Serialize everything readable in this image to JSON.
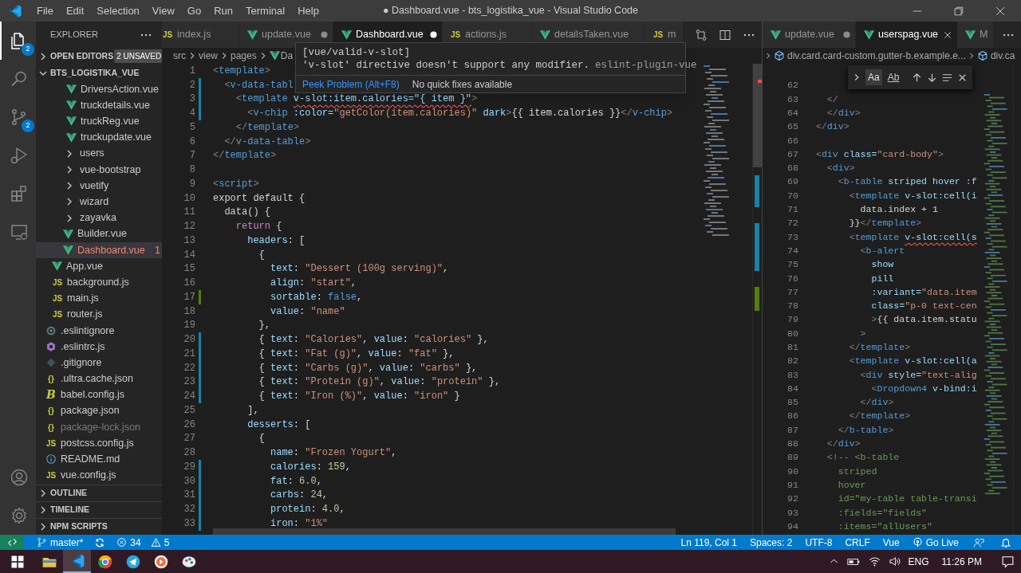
{
  "window": {
    "title": "● Dashboard.vue - bts_logistika_vue - Visual Studio Code"
  },
  "menu": [
    "File",
    "Edit",
    "Selection",
    "View",
    "Go",
    "Run",
    "Terminal",
    "Help"
  ],
  "activity_bar": {
    "items": [
      {
        "kind": "explorer",
        "selected": true,
        "badge": "2"
      },
      {
        "kind": "search",
        "selected": false
      },
      {
        "kind": "source-control",
        "selected": false,
        "badge": "2"
      },
      {
        "kind": "run",
        "selected": false
      },
      {
        "kind": "extensions",
        "selected": false
      },
      {
        "kind": "remote",
        "selected": false
      }
    ],
    "bottom": [
      {
        "kind": "account"
      },
      {
        "kind": "settings"
      }
    ]
  },
  "sidebar": {
    "title": "EXPLORER",
    "sections": [
      {
        "title": "OPEN EDITORS",
        "expanded": false,
        "badge": "2 UNSAVED"
      },
      {
        "title": "BTS_LOGISTIKA_VUE",
        "expanded": true
      }
    ],
    "tree": [
      {
        "children": [
          {
            "children": [
              {
                "children": [
                  {
                    "label": "DriversAction.vue",
                    "kind": "vue",
                    "selected": false,
                    "dimmed": false
                  },
                  {
                    "label": "truckdetails.vue",
                    "kind": "vue",
                    "selected": false,
                    "dimmed": false
                  },
                  {
                    "label": "truckReg.vue",
                    "kind": "vue",
                    "selected": false,
                    "dimmed": false
                  },
                  {
                    "label": "truckupdate.vue",
                    "kind": "vue",
                    "selected": false,
                    "dimmed": false
                  }
                ]
              },
              {
                "label": "users",
                "kind": "folder",
                "expanded": false,
                "selected": false,
                "dimmed": false
              },
              {
                "label": "vue-bootstrap",
                "kind": "folder",
                "expanded": false,
                "selected": false,
                "dimmed": false
              },
              {
                "label": "vuetify",
                "kind": "folder",
                "expanded": false,
                "selected": false,
                "dimmed": false
              },
              {
                "label": "wizard",
                "kind": "folder",
                "expanded": false,
                "selected": false,
                "dimmed": false
              },
              {
                "label": "zayavka",
                "kind": "folder",
                "expanded": false,
                "selected": false,
                "dimmed": false
              },
              {
                "label": "Builder.vue",
                "kind": "vue",
                "selected": false,
                "dimmed": false
              },
              {
                "label": "Dashboard.vue",
                "kind": "vue",
                "selected": true,
                "dimmed": false,
                "problems": "1"
              }
            ]
          },
          {
            "label": "App.vue",
            "kind": "vue",
            "selected": false,
            "dimmed": false
          },
          {
            "label": "background.js",
            "kind": "js",
            "icon_label": "JS",
            "selected": false,
            "dimmed": false
          },
          {
            "label": "main.js",
            "kind": "js",
            "icon_label": "JS",
            "selected": false,
            "dimmed": false
          },
          {
            "label": "router.js",
            "kind": "js",
            "icon_label": "JS",
            "selected": false,
            "dimmed": false
          }
        ]
      },
      {
        "label": ".eslintignore",
        "kind": "ignore",
        "selected": false,
        "dimmed": false
      },
      {
        "label": ".eslintrc.js",
        "kind": "lint",
        "selected": false,
        "dimmed": false
      },
      {
        "label": ".gitignore",
        "kind": "git",
        "selected": false,
        "dimmed": false
      },
      {
        "label": ".ultra.cache.json",
        "kind": "json",
        "icon_label": "{}",
        "selected": false,
        "dimmed": false
      },
      {
        "label": "babel.config.js",
        "kind": "babel",
        "icon_label": "B",
        "selected": false,
        "dimmed": false
      },
      {
        "label": "package.json",
        "kind": "json",
        "icon_label": "{}",
        "selected": false,
        "dimmed": false
      },
      {
        "label": "package-lock.json",
        "kind": "json",
        "icon_label": "{}",
        "selected": false,
        "dimmed": true
      },
      {
        "label": "postcss.config.js",
        "kind": "js",
        "icon_label": "JS",
        "selected": false,
        "dimmed": false
      },
      {
        "label": "README.md",
        "kind": "info",
        "selected": false,
        "dimmed": false
      },
      {
        "label": "vue.config.js",
        "kind": "js",
        "icon_label": "JS",
        "selected": false,
        "dimmed": false
      }
    ],
    "bottom_sections": [
      {
        "title": "OUTLINE",
        "expanded": false
      },
      {
        "title": "TIMELINE",
        "expanded": false
      },
      {
        "title": "NPM SCRIPTS",
        "expanded": false
      }
    ]
  },
  "editor_groups": [
    {
      "tabs": [
        {
          "label": "index.js",
          "kind": "js",
          "icon_label": "JS",
          "selected": false,
          "dirty": false
        },
        {
          "label": "update.vue",
          "kind": "vue",
          "selected": false,
          "dirty": true
        },
        {
          "label": "Dashboard.vue",
          "kind": "vue",
          "selected": true,
          "dirty": true
        },
        {
          "label": "actions.js",
          "kind": "js",
          "icon_label": "JS",
          "selected": false,
          "dirty": false
        },
        {
          "label": "detailsTaken.vue",
          "kind": "vue",
          "selected": false,
          "dirty": false
        },
        {
          "label": "m",
          "kind": "js",
          "icon_label": "JS",
          "selected": false,
          "dirty": false
        }
      ],
      "breadcrumbs": [
        {
          "label": "src",
          "kind": "folder"
        },
        {
          "label": "view",
          "kind": "folder"
        },
        {
          "label": "pages",
          "kind": "folder"
        },
        {
          "label": "Da",
          "kind": "vue"
        }
      ],
      "hover": {
        "rule": "[vue/valid-v-slot]",
        "message": "'v-slot' directive doesn't support any modifier.",
        "source": "eslint-plugin-vue",
        "actions": [
          {
            "label": "Peek Problem (Alt+F8)",
            "kind": "link"
          },
          {
            "label": "No quick fixes available",
            "kind": "note"
          }
        ]
      },
      "lines": [
        {
          "n": "1",
          "kind": "unchanged",
          "tokens": [
            {
              "kind": "p",
              "t": "<"
            },
            {
              "kind": "tag",
              "t": "template"
            },
            {
              "kind": "p",
              "t": ">"
            }
          ]
        },
        {
          "n": "2",
          "kind": "modified",
          "tokens": [
            {
              "kind": "p",
              "t": "  <"
            },
            {
              "kind": "tag",
              "t": "v-data-tabl"
            }
          ]
        },
        {
          "n": "3",
          "kind": "modified",
          "tokens": [
            {
              "kind": "p",
              "t": "    <"
            },
            {
              "kind": "tag",
              "t": "template "
            },
            {
              "kind": "err",
              "t": "v-slot:item.calories=\"{ item }\""
            },
            {
              "kind": "p",
              "t": ">"
            }
          ]
        },
        {
          "n": "4",
          "kind": "modified",
          "tokens": [
            {
              "kind": "p",
              "t": "      <"
            },
            {
              "kind": "tag",
              "t": "v-chip"
            },
            {
              "kind": "attr",
              "t": " :color="
            },
            {
              "kind": "str",
              "t": "\"getColor(item.calories)\""
            },
            {
              "kind": "attr",
              "t": " dark"
            },
            {
              "kind": "p",
              "t": ">"
            },
            {
              "kind": "txt",
              "t": "{{ item.calories }}"
            },
            {
              "kind": "p",
              "t": "</"
            },
            {
              "kind": "tag",
              "t": "v-chip"
            },
            {
              "kind": "p",
              "t": ">"
            }
          ]
        },
        {
          "n": "5",
          "kind": "unchanged",
          "tokens": [
            {
              "kind": "p",
              "t": "    </"
            },
            {
              "kind": "tag",
              "t": "template"
            },
            {
              "kind": "p",
              "t": ">"
            }
          ]
        },
        {
          "n": "6",
          "kind": "unchanged",
          "tokens": [
            {
              "kind": "p",
              "t": "  </"
            },
            {
              "kind": "tag",
              "t": "v-data-table"
            },
            {
              "kind": "p",
              "t": ">"
            }
          ]
        },
        {
          "n": "7",
          "kind": "unchanged",
          "tokens": [
            {
              "kind": "p",
              "t": "</"
            },
            {
              "kind": "tag",
              "t": "template"
            },
            {
              "kind": "p",
              "t": ">"
            }
          ]
        },
        {
          "n": "8",
          "kind": "unchanged"
        },
        {
          "n": "9",
          "kind": "unchanged",
          "tokens": [
            {
              "kind": "p",
              "t": "<"
            },
            {
              "kind": "tag",
              "t": "script"
            },
            {
              "kind": "p",
              "t": ">"
            }
          ]
        },
        {
          "n": "10",
          "kind": "unchanged",
          "tokens": [
            {
              "kind": "txt",
              "t": "export default {"
            }
          ]
        },
        {
          "n": "11",
          "kind": "unchanged",
          "tokens": [
            {
              "kind": "txt",
              "t": "  data() {"
            }
          ]
        },
        {
          "n": "12",
          "kind": "unchanged",
          "tokens": [
            {
              "kind": "kw",
              "t": "    return"
            },
            {
              "kind": "txt",
              "t": " {"
            }
          ]
        },
        {
          "n": "13",
          "kind": "unchanged",
          "tokens": [
            {
              "kind": "prop",
              "t": "      headers"
            },
            {
              "kind": "txt",
              "t": ": ["
            }
          ]
        },
        {
          "n": "14",
          "kind": "unchanged",
          "tokens": [
            {
              "kind": "txt",
              "t": "        {"
            }
          ]
        },
        {
          "n": "15",
          "kind": "unchanged",
          "tokens": [
            {
              "kind": "prop",
              "t": "          text"
            },
            {
              "kind": "txt",
              "t": ": "
            },
            {
              "kind": "str",
              "t": "\"Dessert (100g serving)\""
            },
            {
              "kind": "txt",
              "t": ","
            }
          ]
        },
        {
          "n": "16",
          "kind": "unchanged",
          "tokens": [
            {
              "kind": "prop",
              "t": "          align"
            },
            {
              "kind": "txt",
              "t": ": "
            },
            {
              "kind": "str",
              "t": "\"start\""
            },
            {
              "kind": "txt",
              "t": ","
            }
          ]
        },
        {
          "n": "17",
          "kind": "added",
          "tokens": [
            {
              "kind": "prop",
              "t": "          sortable"
            },
            {
              "kind": "txt",
              "t": ": "
            },
            {
              "kind": "bool",
              "t": "false"
            },
            {
              "kind": "txt",
              "t": ","
            }
          ]
        },
        {
          "n": "18",
          "kind": "unchanged",
          "tokens": [
            {
              "kind": "prop",
              "t": "          value"
            },
            {
              "kind": "txt",
              "t": ": "
            },
            {
              "kind": "str",
              "t": "\"name\""
            }
          ]
        },
        {
          "n": "19",
          "kind": "unchanged",
          "tokens": [
            {
              "kind": "txt",
              "t": "        },"
            }
          ]
        },
        {
          "n": "20",
          "kind": "modified",
          "tokens": [
            {
              "kind": "txt",
              "t": "        { "
            },
            {
              "kind": "prop",
              "t": "text"
            },
            {
              "kind": "txt",
              "t": ": "
            },
            {
              "kind": "str",
              "t": "\"Calories\""
            },
            {
              "kind": "txt",
              "t": ", "
            },
            {
              "kind": "prop",
              "t": "value"
            },
            {
              "kind": "txt",
              "t": ": "
            },
            {
              "kind": "str",
              "t": "\"calories\""
            },
            {
              "kind": "txt",
              "t": " },"
            }
          ]
        },
        {
          "n": "21",
          "kind": "modified",
          "tokens": [
            {
              "kind": "txt",
              "t": "        { "
            },
            {
              "kind": "prop",
              "t": "text"
            },
            {
              "kind": "txt",
              "t": ": "
            },
            {
              "kind": "str",
              "t": "\"Fat (g)\""
            },
            {
              "kind": "txt",
              "t": ", "
            },
            {
              "kind": "prop",
              "t": "value"
            },
            {
              "kind": "txt",
              "t": ": "
            },
            {
              "kind": "str",
              "t": "\"fat\""
            },
            {
              "kind": "txt",
              "t": " },"
            }
          ]
        },
        {
          "n": "22",
          "kind": "modified",
          "tokens": [
            {
              "kind": "txt",
              "t": "        { "
            },
            {
              "kind": "prop",
              "t": "text"
            },
            {
              "kind": "txt",
              "t": ": "
            },
            {
              "kind": "str",
              "t": "\"Carbs (g)\""
            },
            {
              "kind": "txt",
              "t": ", "
            },
            {
              "kind": "prop",
              "t": "value"
            },
            {
              "kind": "txt",
              "t": ": "
            },
            {
              "kind": "str",
              "t": "\"carbs\""
            },
            {
              "kind": "txt",
              "t": " },"
            }
          ]
        },
        {
          "n": "23",
          "kind": "modified",
          "tokens": [
            {
              "kind": "txt",
              "t": "        { "
            },
            {
              "kind": "prop",
              "t": "text"
            },
            {
              "kind": "txt",
              "t": ": "
            },
            {
              "kind": "str",
              "t": "\"Protein (g)\""
            },
            {
              "kind": "txt",
              "t": ", "
            },
            {
              "kind": "prop",
              "t": "value"
            },
            {
              "kind": "txt",
              "t": ": "
            },
            {
              "kind": "str",
              "t": "\"protein\""
            },
            {
              "kind": "txt",
              "t": " },"
            }
          ]
        },
        {
          "n": "24",
          "kind": "modified",
          "tokens": [
            {
              "kind": "txt",
              "t": "        { "
            },
            {
              "kind": "prop",
              "t": "text"
            },
            {
              "kind": "txt",
              "t": ": "
            },
            {
              "kind": "str",
              "t": "\"Iron (%)\""
            },
            {
              "kind": "txt",
              "t": ", "
            },
            {
              "kind": "prop",
              "t": "value"
            },
            {
              "kind": "txt",
              "t": ": "
            },
            {
              "kind": "str",
              "t": "\"iron\""
            },
            {
              "kind": "txt",
              "t": " }"
            }
          ]
        },
        {
          "n": "25",
          "kind": "unchanged",
          "tokens": [
            {
              "kind": "txt",
              "t": "      ],"
            }
          ]
        },
        {
          "n": "26",
          "kind": "unchanged",
          "tokens": [
            {
              "kind": "prop",
              "t": "      desserts"
            },
            {
              "kind": "txt",
              "t": ": ["
            }
          ]
        },
        {
          "n": "27",
          "kind": "unchanged",
          "tokens": [
            {
              "kind": "txt",
              "t": "        {"
            }
          ]
        },
        {
          "n": "28",
          "kind": "unchanged",
          "tokens": [
            {
              "kind": "prop",
              "t": "          name"
            },
            {
              "kind": "txt",
              "t": ": "
            },
            {
              "kind": "str",
              "t": "\"Frozen Yogurt\""
            },
            {
              "kind": "txt",
              "t": ","
            }
          ]
        },
        {
          "n": "29",
          "kind": "modified",
          "tokens": [
            {
              "kind": "prop",
              "t": "          calories"
            },
            {
              "kind": "txt",
              "t": ": "
            },
            {
              "kind": "num",
              "t": "159"
            },
            {
              "kind": "txt",
              "t": ","
            }
          ]
        },
        {
          "n": "30",
          "kind": "modified",
          "tokens": [
            {
              "kind": "prop",
              "t": "          fat"
            },
            {
              "kind": "txt",
              "t": ": "
            },
            {
              "kind": "num",
              "t": "6.0"
            },
            {
              "kind": "txt",
              "t": ","
            }
          ]
        },
        {
          "n": "31",
          "kind": "modified",
          "tokens": [
            {
              "kind": "prop",
              "t": "          carbs"
            },
            {
              "kind": "txt",
              "t": ": "
            },
            {
              "kind": "num",
              "t": "24"
            },
            {
              "kind": "txt",
              "t": ","
            }
          ]
        },
        {
          "n": "32",
          "kind": "modified",
          "tokens": [
            {
              "kind": "prop",
              "t": "          protein"
            },
            {
              "kind": "txt",
              "t": ": "
            },
            {
              "kind": "num",
              "t": "4.0"
            },
            {
              "kind": "txt",
              "t": ","
            }
          ]
        },
        {
          "n": "33",
          "kind": "modified",
          "tokens": [
            {
              "kind": "prop",
              "t": "          iron"
            },
            {
              "kind": "txt",
              "t": ": "
            },
            {
              "kind": "str",
              "t": "\"1%\""
            }
          ]
        }
      ]
    },
    {
      "tabs": [
        {
          "label": "update.vue",
          "kind": "vue",
          "selected": false,
          "dirty": true
        },
        {
          "label": "userspag.vue",
          "kind": "vue",
          "selected": true,
          "dirty": false
        },
        {
          "label": "M",
          "kind": "vue",
          "selected": false,
          "dirty": false
        }
      ],
      "breadcrumbs": [
        {
          "label": "div.card.card-custom.gutter-b.example.e...",
          "kind": "element"
        },
        {
          "label": "div.ca",
          "kind": "element"
        }
      ],
      "find_widget": {
        "toggles": [
          {
            "label": "Aa",
            "selected": true
          },
          {
            "label": "Ab",
            "selected": false
          }
        ]
      },
      "lines": [
        {
          "n": "62",
          "kind": "unchanged"
        },
        {
          "n": "63",
          "kind": "unchanged",
          "tokens": [
            {
              "kind": "p",
              "t": "    </"
            }
          ]
        },
        {
          "n": "64",
          "kind": "unchanged",
          "tokens": [
            {
              "kind": "p",
              "t": "    </"
            },
            {
              "kind": "tag",
              "t": "div"
            },
            {
              "kind": "p",
              "t": ">"
            }
          ]
        },
        {
          "n": "65",
          "kind": "unchanged",
          "tokens": [
            {
              "kind": "p",
              "t": "  </"
            },
            {
              "kind": "tag",
              "t": "div"
            },
            {
              "kind": "p",
              "t": ">"
            }
          ]
        },
        {
          "n": "66",
          "kind": "unchanged"
        },
        {
          "n": "67",
          "kind": "unchanged",
          "tokens": [
            {
              "kind": "p",
              "t": "  <"
            },
            {
              "kind": "tag",
              "t": "div"
            },
            {
              "kind": "attr",
              "t": " class="
            },
            {
              "kind": "str",
              "t": "\"card-body\""
            },
            {
              "kind": "p",
              "t": ">"
            }
          ]
        },
        {
          "n": "68",
          "kind": "unchanged",
          "tokens": [
            {
              "kind": "p",
              "t": "    <"
            },
            {
              "kind": "tag",
              "t": "div"
            },
            {
              "kind": "p",
              "t": ">"
            }
          ]
        },
        {
          "n": "69",
          "kind": "unchanged",
          "tokens": [
            {
              "kind": "p",
              "t": "      <"
            },
            {
              "kind": "tag",
              "t": "b-table"
            },
            {
              "kind": "attr",
              "t": " striped hover :f"
            }
          ]
        },
        {
          "n": "70",
          "kind": "unchanged",
          "tokens": [
            {
              "kind": "p",
              "t": "        <"
            },
            {
              "kind": "tag",
              "t": "template"
            },
            {
              "kind": "attr",
              "t": " v-slot:cell(i"
            }
          ]
        },
        {
          "n": "71",
          "kind": "unchanged",
          "tokens": [
            {
              "kind": "txt",
              "t": "          data.index + 1"
            }
          ]
        },
        {
          "n": "72",
          "kind": "unchanged",
          "tokens": [
            {
              "kind": "txt",
              "t": "        }}"
            },
            {
              "kind": "p",
              "t": "</"
            },
            {
              "kind": "tag",
              "t": "template"
            },
            {
              "kind": "p",
              "t": ">"
            }
          ]
        },
        {
          "n": "73",
          "kind": "unchanged",
          "tokens": [
            {
              "kind": "p",
              "t": "        <"
            },
            {
              "kind": "tag",
              "t": "template "
            },
            {
              "kind": "err",
              "t": "v-slot:cell(s"
            }
          ]
        },
        {
          "n": "74",
          "kind": "unchanged",
          "tokens": [
            {
              "kind": "p",
              "t": "          <"
            },
            {
              "kind": "tag",
              "t": "b-alert"
            }
          ]
        },
        {
          "n": "75",
          "kind": "unchanged",
          "tokens": [
            {
              "kind": "attr",
              "t": "            show"
            }
          ]
        },
        {
          "n": "76",
          "kind": "unchanged",
          "tokens": [
            {
              "kind": "attr",
              "t": "            pill"
            }
          ]
        },
        {
          "n": "77",
          "kind": "unchanged",
          "tokens": [
            {
              "kind": "attr",
              "t": "            :variant="
            },
            {
              "kind": "str",
              "t": "\"data.item"
            }
          ]
        },
        {
          "n": "78",
          "kind": "unchanged",
          "tokens": [
            {
              "kind": "attr",
              "t": "            class="
            },
            {
              "kind": "str",
              "t": "\"p-0 text-cen"
            }
          ]
        },
        {
          "n": "79",
          "kind": "unchanged",
          "tokens": [
            {
              "kind": "p",
              "t": "            >"
            },
            {
              "kind": "txt",
              "t": "{{ data.item.statu"
            }
          ]
        },
        {
          "n": "80",
          "kind": "unchanged",
          "tokens": [
            {
              "kind": "p",
              "t": "          >"
            }
          ]
        },
        {
          "n": "81",
          "kind": "unchanged",
          "tokens": [
            {
              "kind": "p",
              "t": "        </"
            },
            {
              "kind": "tag",
              "t": "template"
            },
            {
              "kind": "p",
              "t": ">"
            }
          ]
        },
        {
          "n": "82",
          "kind": "unchanged",
          "tokens": [
            {
              "kind": "p",
              "t": "        <"
            },
            {
              "kind": "tag",
              "t": "template"
            },
            {
              "kind": "attr",
              "t": " v-slot:cell(a"
            }
          ]
        },
        {
          "n": "83",
          "kind": "unchanged",
          "tokens": [
            {
              "kind": "p",
              "t": "          <"
            },
            {
              "kind": "tag",
              "t": "div"
            },
            {
              "kind": "attr",
              "t": " style="
            },
            {
              "kind": "str",
              "t": "\"text-alig"
            }
          ]
        },
        {
          "n": "84",
          "kind": "unchanged",
          "tokens": [
            {
              "kind": "p",
              "t": "            <"
            },
            {
              "kind": "tag",
              "t": "Dropdown4"
            },
            {
              "kind": "attr",
              "t": " v-bind:i"
            }
          ]
        },
        {
          "n": "85",
          "kind": "unchanged",
          "tokens": [
            {
              "kind": "p",
              "t": "          </"
            },
            {
              "kind": "tag",
              "t": "div"
            },
            {
              "kind": "p",
              "t": ">"
            }
          ]
        },
        {
          "n": "86",
          "kind": "unchanged",
          "tokens": [
            {
              "kind": "p",
              "t": "        </"
            },
            {
              "kind": "tag",
              "t": "template"
            },
            {
              "kind": "p",
              "t": ">"
            }
          ]
        },
        {
          "n": "87",
          "kind": "unchanged",
          "tokens": [
            {
              "kind": "p",
              "t": "      </"
            },
            {
              "kind": "tag",
              "t": "b-table"
            },
            {
              "kind": "p",
              "t": ">"
            }
          ]
        },
        {
          "n": "88",
          "kind": "unchanged",
          "tokens": [
            {
              "kind": "p",
              "t": "    </"
            },
            {
              "kind": "tag",
              "t": "div"
            },
            {
              "kind": "p",
              "t": ">"
            }
          ]
        },
        {
          "n": "89",
          "kind": "unchanged",
          "tokens": [
            {
              "kind": "cmt",
              "t": "    <!-- <b-table"
            }
          ]
        },
        {
          "n": "90",
          "kind": "unchanged",
          "tokens": [
            {
              "kind": "cmt",
              "t": "      striped"
            }
          ]
        },
        {
          "n": "91",
          "kind": "unchanged",
          "tokens": [
            {
              "kind": "cmt",
              "t": "      hover"
            }
          ]
        },
        {
          "n": "92",
          "kind": "unchanged",
          "tokens": [
            {
              "kind": "cmt",
              "t": "      id=\"my-table table-transi"
            }
          ]
        },
        {
          "n": "93",
          "kind": "unchanged",
          "tokens": [
            {
              "kind": "cmt",
              "t": "      :fields=\"fields\""
            }
          ]
        },
        {
          "n": "94",
          "kind": "unchanged",
          "tokens": [
            {
              "kind": "cmt",
              "t": "      :items=\"allUsers\""
            }
          ]
        }
      ]
    }
  ],
  "status_bar": {
    "left": [
      {
        "kind": "remote"
      },
      {
        "kind": "branch",
        "text": "master*"
      },
      {
        "kind": "sync"
      },
      {
        "kind": "errors",
        "text": "34"
      },
      {
        "kind": "warnings",
        "text": "5"
      }
    ],
    "right": [
      {
        "kind": "text",
        "text": "Ln 119, Col 1"
      },
      {
        "kind": "text",
        "text": "Spaces: 2"
      },
      {
        "kind": "text",
        "text": "UTF-8"
      },
      {
        "kind": "text",
        "text": "CRLF"
      },
      {
        "kind": "text",
        "text": "Vue"
      },
      {
        "kind": "go-live",
        "text": "Go Live"
      },
      {
        "kind": "feedback"
      },
      {
        "kind": "bell"
      }
    ]
  },
  "taskbar": {
    "apps": [
      {
        "kind": "start",
        "selected": false
      },
      {
        "kind": "files",
        "selected": false
      },
      {
        "kind": "editor",
        "selected": true
      },
      {
        "kind": "browser",
        "selected": false
      },
      {
        "kind": "messenger",
        "selected": false
      },
      {
        "kind": "media",
        "selected": false
      },
      {
        "kind": "paint",
        "selected": false
      }
    ],
    "tray": {
      "language": "ENG",
      "time": "11:26 PM"
    }
  }
}
